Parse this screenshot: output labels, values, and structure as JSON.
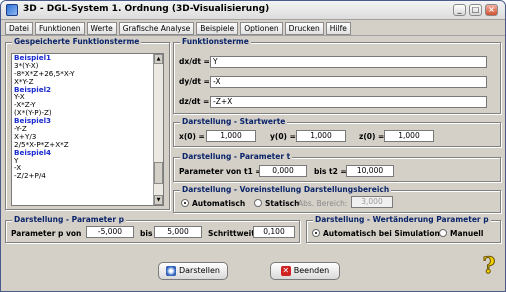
{
  "window": {
    "title": "3D - DGL-System 1. Ordnung (3D-Visualisierung)"
  },
  "menu": [
    "Datei",
    "Funktionen",
    "Werte",
    "Grafische Analyse",
    "Beispiele",
    "Optionen",
    "Drucken",
    "Hilfe"
  ],
  "saved": {
    "title": "Gespeicherte Funktionsterme",
    "lines": [
      {
        "text": "Beispiel1",
        "header": true
      },
      {
        "text": "3*(Y-X)",
        "header": false
      },
      {
        "text": "-8*X*Z+26,5*X-Y",
        "header": false
      },
      {
        "text": "X*Y-Z",
        "header": false
      },
      {
        "text": "Beispiel2",
        "header": true
      },
      {
        "text": "Y-X",
        "header": false
      },
      {
        "text": "-X*Z-Y",
        "header": false
      },
      {
        "text": "(X*(Y-P)-Z)",
        "header": false
      },
      {
        "text": "Beispiel3",
        "header": true
      },
      {
        "text": "-Y-Z",
        "header": false
      },
      {
        "text": "X+Y/3",
        "header": false
      },
      {
        "text": "2/5*X-P*Z+X*Z",
        "header": false
      },
      {
        "text": "Beispiel4",
        "header": true
      },
      {
        "text": "Y",
        "header": false
      },
      {
        "text": "-X",
        "header": false
      },
      {
        "text": "-Z/2+P/4",
        "header": false
      },
      {
        "text": "",
        "header": false
      },
      {
        "text": "",
        "header": false
      },
      {
        "text": "",
        "header": false
      }
    ]
  },
  "funktionsterme": {
    "title": "Funktionsterme",
    "dx_label": "dx/dt =",
    "dx_value": "Y",
    "dy_label": "dy/dt =",
    "dy_value": "-X",
    "dz_label": "dz/dt =",
    "dz_value": "-Z+X"
  },
  "startwerte": {
    "title": "Darstellung - Startwerte",
    "x_label": "x(0) =",
    "x_value": "1,000",
    "y_label": "y(0) =",
    "y_value": "1,000",
    "z_label": "z(0) =",
    "z_value": "1,000"
  },
  "param_t": {
    "title": "Darstellung - Parameter t",
    "from_label": "Parameter von t1 =",
    "from_value": "0,000",
    "to_label": "bis t2 =",
    "to_value": "10,000"
  },
  "bereich": {
    "title": "Darstellung - Voreinstellung Darstellungsbereich",
    "auto_label": "Automatisch",
    "static_label": "Statisch",
    "abs_label": "Abs. Bereich:",
    "abs_value": "3,000",
    "selected": "auto"
  },
  "param_p": {
    "title": "Darstellung - Parameter p",
    "from_label": "Parameter p von",
    "from_value": "-5,000",
    "to_label": "bis",
    "to_value": "5,000",
    "step_label": "Schrittweite:",
    "step_value": "0,100"
  },
  "wertaenderung": {
    "title": "Darstellung - Wertänderung Parameter p",
    "auto_label": "Automatisch bei Simulation",
    "manual_label": "Manuell",
    "selected": "auto"
  },
  "buttons": {
    "draw": "Darstellen",
    "quit": "Beenden"
  },
  "colors": {
    "list_header": "#1a2bd0",
    "group_title": "#0a246a",
    "help": "#f6d100"
  }
}
